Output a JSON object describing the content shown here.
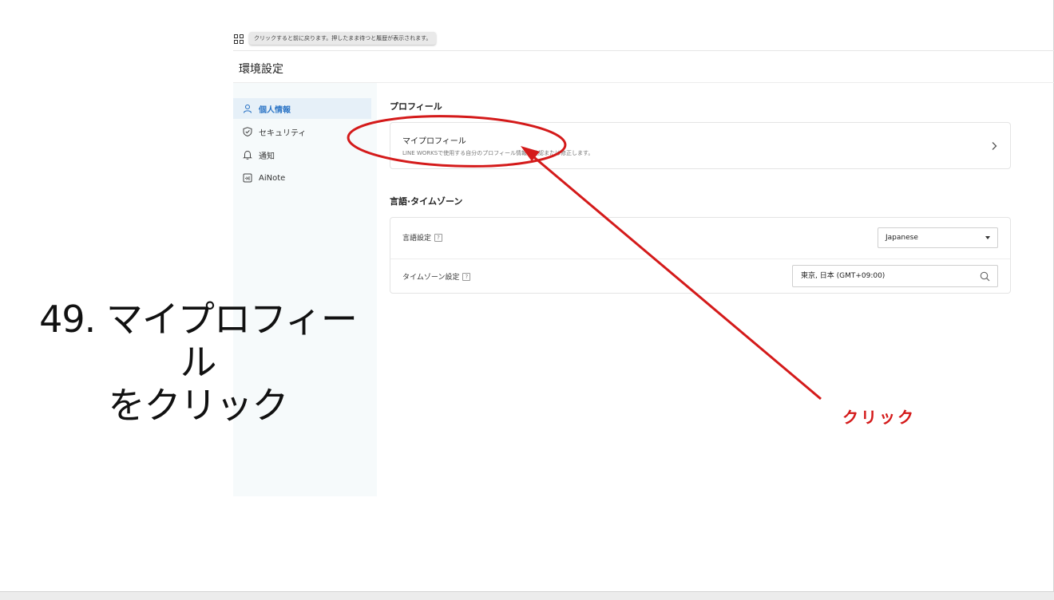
{
  "toolbar": {
    "tooltip": "クリックすると前に戻ります。押したまま待つと履歴が表示されます。"
  },
  "page": {
    "title": "環境設定"
  },
  "sidebar": {
    "items": [
      {
        "label": "個人情報",
        "icon": "person-icon",
        "active": true
      },
      {
        "label": "セキュリティ",
        "icon": "shield-icon",
        "active": false
      },
      {
        "label": "通知",
        "icon": "bell-icon",
        "active": false
      },
      {
        "label": "AiNote",
        "icon": "ainote-icon",
        "active": false
      }
    ]
  },
  "profile": {
    "section_title": "プロフィール",
    "card_title": "マイプロフィール",
    "card_desc": "LINE WORKSで使用する自分のプロフィール情報を確認または修正します。"
  },
  "language": {
    "section_title": "言語·タイムゾーン",
    "lang_label": "言語設定",
    "lang_value": "Japanese",
    "tz_label": "タイムゾーン設定",
    "tz_value": "東京, 日本 (GMT+09:00)",
    "help_mark": "?"
  },
  "annotation": {
    "caption_line1": "49. マイプロフィール",
    "caption_line2": "をクリック",
    "click_label": "クリック",
    "color": "#d41a1a"
  }
}
